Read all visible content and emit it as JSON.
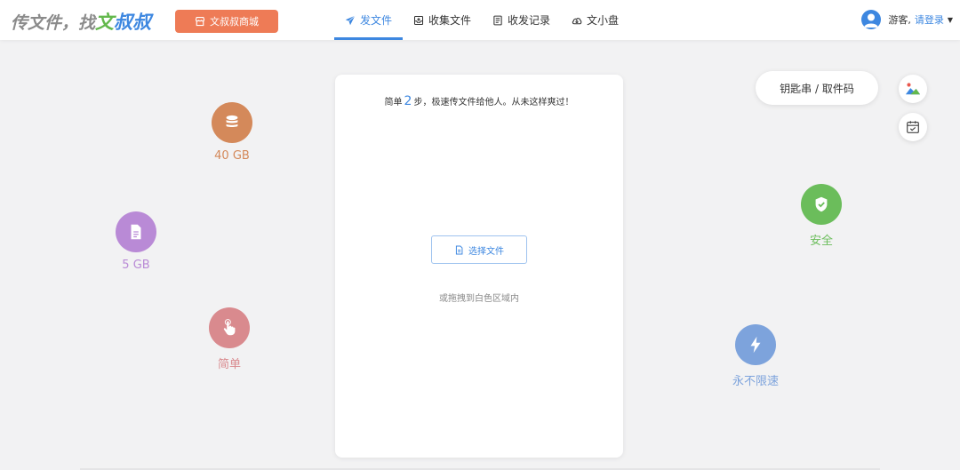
{
  "header": {
    "logo": {
      "part1": "传文件，找",
      "part2": "文",
      "part3": "叔叔"
    },
    "shop_button": "文叔叔商城",
    "nav": [
      {
        "label": "发文件",
        "icon": "paper-plane-icon",
        "active": true
      },
      {
        "label": "收集文件",
        "icon": "inbox-icon",
        "active": false
      },
      {
        "label": "收发记录",
        "icon": "record-list-icon",
        "active": false
      },
      {
        "label": "文小盘",
        "icon": "cloud-drive-icon",
        "active": false
      }
    ],
    "user": {
      "guest": "游客,",
      "login": "请登录",
      "caret": "▼"
    }
  },
  "card": {
    "tagline_before": "简单",
    "tagline_number": "2",
    "tagline_after": "步，极速传文件给他人。从未这样爽过！",
    "choose_button": "选择文件",
    "drag_hint": "或拖拽到白色区域内"
  },
  "features": [
    {
      "label": "40 GB",
      "icon": "database-icon",
      "color": "#d4895a"
    },
    {
      "label": "5 GB",
      "icon": "document-icon",
      "color": "#b98ad6"
    },
    {
      "label": "简单",
      "icon": "pointer-hand-icon",
      "color": "#d98a8e"
    },
    {
      "label": "安全",
      "icon": "shield-check-icon",
      "color": "#6bbd5b"
    },
    {
      "label": "永不限速",
      "icon": "lightning-icon",
      "color": "#7da3dc"
    }
  ],
  "key_button": "钥匙串 / 取件码",
  "side_icons": [
    "image-icon",
    "calendar-check-icon"
  ],
  "colors": {
    "accent": "#3d87e0",
    "shop": "#ee7b56",
    "green": "#63b84c"
  }
}
